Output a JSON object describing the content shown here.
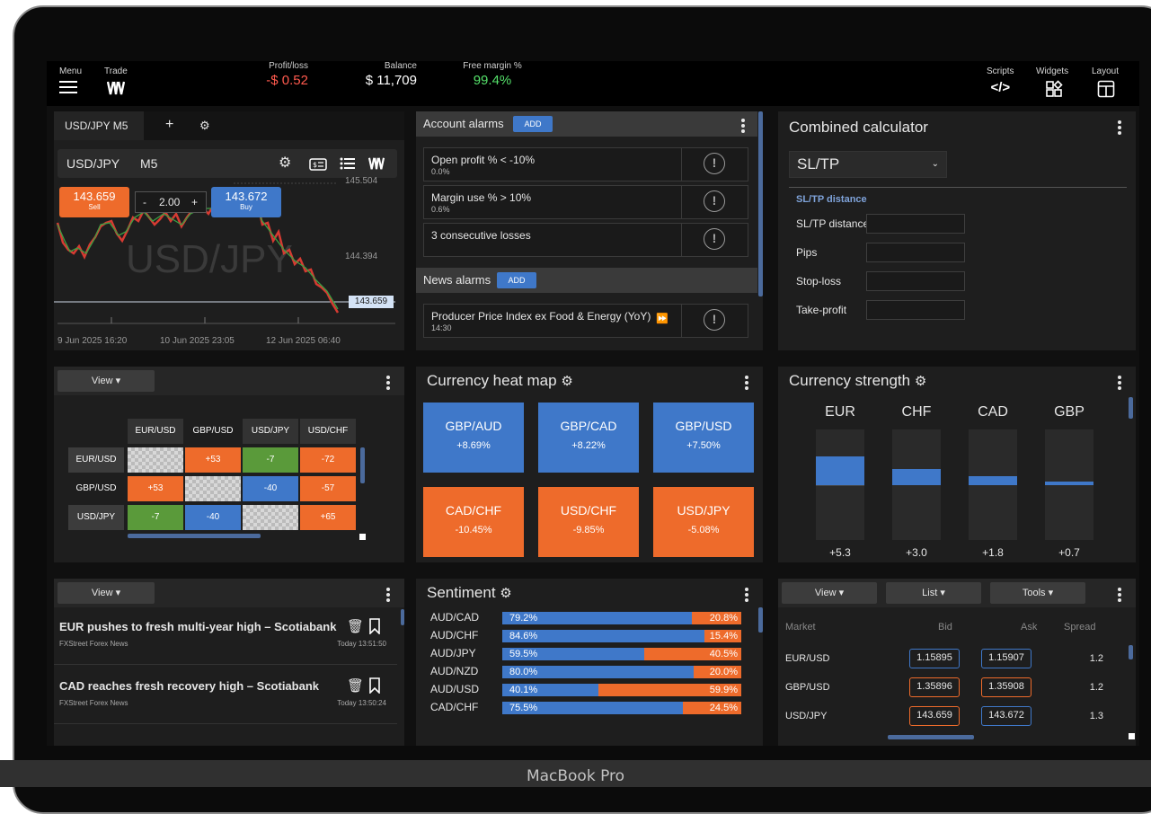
{
  "device_label": "MacBook Pro",
  "topbar": {
    "menu": "Menu",
    "trade": "Trade",
    "profit_label": "Profit/loss",
    "profit_value": "-$ 0.52",
    "balance_label": "Balance",
    "balance_value": "$ 11,709",
    "margin_label": "Free margin %",
    "margin_value": "99.4%",
    "scripts": "Scripts",
    "widgets": "Widgets",
    "layout": "Layout"
  },
  "chart": {
    "tab": "USD/JPY M5",
    "symbol": "USD/JPY",
    "timeframe": "M5",
    "watermark": "USD/JPY",
    "sell_price": "143.659",
    "sell_label": "Sell",
    "buy_price": "143.672",
    "buy_label": "Buy",
    "qty_minus": "-",
    "qty": "2.00",
    "qty_plus": "+",
    "y_ticks": [
      "145.504",
      "144.394"
    ],
    "current_price": "143.659",
    "x_ticks": [
      "9 Jun 2025 16:20",
      "10 Jun 2025 23:05",
      "12 Jun 2025 06:40"
    ]
  },
  "alarms": {
    "account_title": "Account alarms",
    "add": "ADD",
    "account_items": [
      {
        "title": "Open profit % < -10%",
        "sub": "0.0%"
      },
      {
        "title": "Margin use % > 10%",
        "sub": "0.6%"
      },
      {
        "title": "3 consecutive losses",
        "sub": ""
      }
    ],
    "news_title": "News alarms",
    "news_items": [
      {
        "title": "Producer Price Index ex Food & Energy (YoY)",
        "sub": "14:30"
      }
    ]
  },
  "calculator": {
    "title": "Combined calculator",
    "mode": "SL/TP",
    "section": "SL/TP distance",
    "fields": [
      "SL/TP distance",
      "Pips",
      "Stop-loss",
      "Take-profit"
    ]
  },
  "correlation": {
    "view": "View",
    "cols": [
      "EUR/USD",
      "GBP/USD",
      "USD/JPY",
      "USD/CHF"
    ],
    "rows": [
      {
        "name": "EUR/USD",
        "cells": [
          "",
          "+53",
          "-7",
          "-72"
        ]
      },
      {
        "name": "GBP/USD",
        "cells": [
          "+53",
          "",
          "-40",
          "-57"
        ]
      },
      {
        "name": "USD/JPY",
        "cells": [
          "-7",
          "-40",
          "",
          "+65"
        ]
      }
    ]
  },
  "heatmap": {
    "title": "Currency heat map",
    "tiles": [
      {
        "pair": "GBP/AUD",
        "value": "+8.69%"
      },
      {
        "pair": "GBP/CAD",
        "value": "+8.22%"
      },
      {
        "pair": "GBP/USD",
        "value": "+7.50%"
      },
      {
        "pair": "CAD/CHF",
        "value": "-10.45%"
      },
      {
        "pair": "USD/CHF",
        "value": "-9.85%"
      },
      {
        "pair": "USD/JPY",
        "value": "-5.08%"
      }
    ],
    "colors": {
      "positive": "#3f78c9",
      "negative": "#ee6b2b"
    }
  },
  "strength": {
    "title": "Currency strength",
    "items": [
      {
        "ccy": "EUR",
        "value": "+5.3",
        "level": 5.3
      },
      {
        "ccy": "CHF",
        "value": "+3.0",
        "level": 3.0
      },
      {
        "ccy": "CAD",
        "value": "+1.8",
        "level": 1.8
      },
      {
        "ccy": "GBP",
        "value": "+0.7",
        "level": 0.7
      }
    ]
  },
  "news": {
    "view": "View",
    "items": [
      {
        "headline": "EUR pushes to fresh multi-year high – Scotiabank",
        "source": "FXStreet Forex News",
        "time": "Today 13:51:50"
      },
      {
        "headline": "CAD reaches fresh recovery high – Scotiabank",
        "source": "FXStreet Forex News",
        "time": "Today 13:50:24"
      }
    ]
  },
  "sentiment": {
    "title": "Sentiment",
    "rows": [
      {
        "pair": "AUD/CAD",
        "long": "79.2%",
        "short": "20.8%",
        "long_pct": 79.2
      },
      {
        "pair": "AUD/CHF",
        "long": "84.6%",
        "short": "15.4%",
        "long_pct": 84.6
      },
      {
        "pair": "AUD/JPY",
        "long": "59.5%",
        "short": "40.5%",
        "long_pct": 59.5
      },
      {
        "pair": "AUD/NZD",
        "long": "80.0%",
        "short": "20.0%",
        "long_pct": 80.0
      },
      {
        "pair": "AUD/USD",
        "long": "40.1%",
        "short": "59.9%",
        "long_pct": 40.1
      },
      {
        "pair": "CAD/CHF",
        "long": "75.5%",
        "short": "24.5%",
        "long_pct": 75.5
      }
    ]
  },
  "market": {
    "view": "View",
    "list": "List",
    "tools": "Tools",
    "headers": {
      "market": "Market",
      "bid": "Bid",
      "ask": "Ask",
      "spread": "Spread"
    },
    "rows": [
      {
        "market": "EUR/USD",
        "bid": "1.15895",
        "ask": "1.15907",
        "spread": "1.2",
        "bid_color": "#3f78c9",
        "ask_color": "#3f78c9"
      },
      {
        "market": "GBP/USD",
        "bid": "1.35896",
        "ask": "1.35908",
        "spread": "1.2",
        "bid_color": "#ee6b2b",
        "ask_color": "#ee6b2b"
      },
      {
        "market": "USD/JPY",
        "bid": "143.659",
        "ask": "143.672",
        "spread": "1.3",
        "bid_color": "#ee6b2b",
        "ask_color": "#3f78c9"
      }
    ]
  }
}
